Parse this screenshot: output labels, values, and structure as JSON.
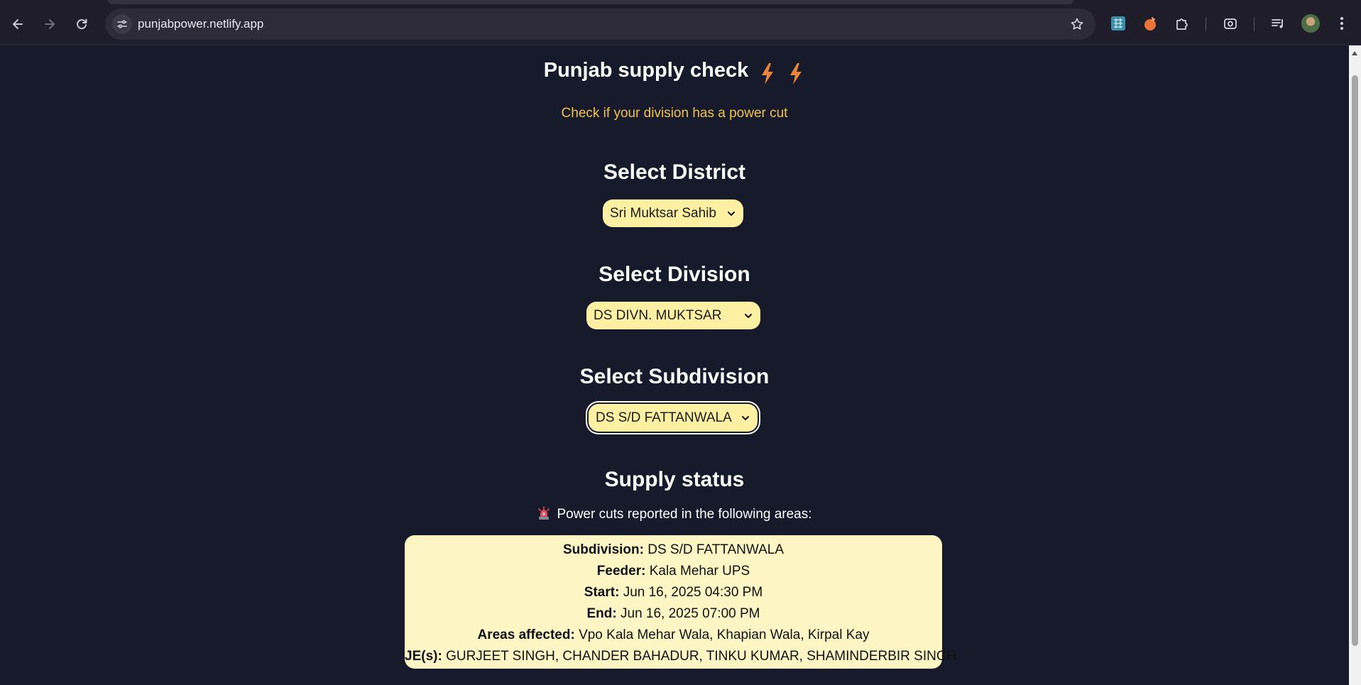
{
  "browser": {
    "url": "punjabpower.netlify.app",
    "icons": [
      "back-icon",
      "forward-icon",
      "reload-icon",
      "site-info-icon",
      "bookmark-star-icon",
      "extension-icon",
      "extension-icon",
      "puzzle-icon",
      "screenshot-icon",
      "media-controls-icon",
      "avatar",
      "menu-icon"
    ]
  },
  "app": {
    "title": "Punjab supply check",
    "subtitle": "Check if your division has a power cut",
    "accent_color": "#f2c14e",
    "background_color": "#161a2b"
  },
  "district": {
    "heading": "Select District",
    "selected": "Sri Muktsar Sahib"
  },
  "division": {
    "heading": "Select Division",
    "selected": "DS DIVN. MUKTSAR"
  },
  "subdivision": {
    "heading": "Select Subdivision",
    "selected": "DS S/D FATTANWALA"
  },
  "status": {
    "heading": "Supply status",
    "message": "Power cuts reported in the following areas:",
    "entry": {
      "subdivision_label": "Subdivision:",
      "subdivision": "DS S/D FATTANWALA",
      "feeder_label": "Feeder:",
      "feeder": "Kala Mehar UPS",
      "start_label": "Start:",
      "start": "Jun 16, 2025 04:30 PM",
      "end_label": "End:",
      "end": "Jun 16, 2025 07:00 PM",
      "areas_label": "Areas affected:",
      "areas": "Vpo Kala Mehar Wala, Khapian Wala, Kirpal Kay",
      "je_label": "JE(s):",
      "je": "GURJEET SINGH, CHANDER BAHADUR, TINKU KUMAR, SHAMINDERBIR SINGH"
    }
  }
}
